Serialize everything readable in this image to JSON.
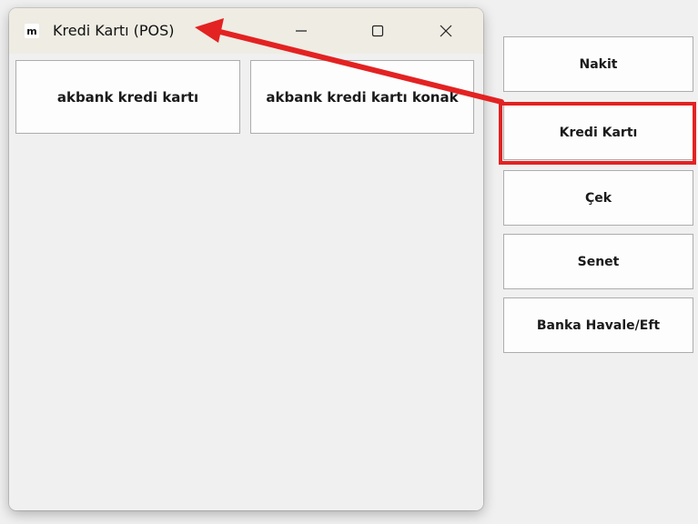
{
  "background_app": {
    "payment_buttons": [
      {
        "label": "Nakit"
      },
      {
        "label": "Kredi Kartı"
      },
      {
        "label": "Çek"
      },
      {
        "label": "Senet"
      },
      {
        "label": "Banka Havale/Eft"
      }
    ],
    "highlighted_button": "Kredi Kartı"
  },
  "window": {
    "icon_glyph": "m",
    "title": "Kredi Kartı (POS)",
    "buttons": {
      "minimize": "minimize-icon",
      "maximize": "maximize-icon",
      "close": "close-icon"
    }
  },
  "pos_options": [
    {
      "label": "akbank kredi kartı"
    },
    {
      "label": "akbank kredi kartı konak"
    }
  ],
  "annotation": {
    "color": "#e32222"
  }
}
